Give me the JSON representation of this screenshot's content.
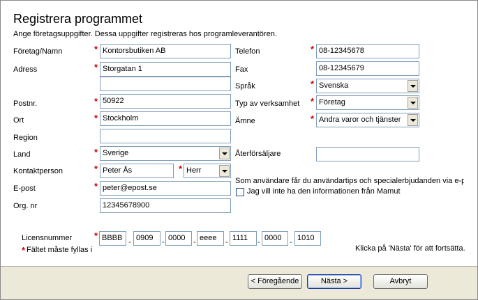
{
  "header": {
    "title": "Registrera programmet",
    "subtitle": "Ange företagsuppgifter. Dessa uppgifter registreras hos programleverantören."
  },
  "left": {
    "company_label": "Företag/Namn",
    "company_value": "Kontorsbutiken AB",
    "address_label": "Adress",
    "address_value": "Storgatan 1",
    "address2_value": "",
    "postal_label": "Postnr.",
    "postal_value": "50922",
    "city_label": "Ort",
    "city_value": "Stockholm",
    "region_label": "Region",
    "region_value": "",
    "country_label": "Land",
    "country_value": "Sverige",
    "contact_label": "Kontaktperson",
    "contact_value": "Peter Ås",
    "salutation_value": "Herr",
    "email_label": "E-post",
    "email_value": "peter@epost.se",
    "org_label": "Org. nr",
    "org_value": "12345678900"
  },
  "right": {
    "phone_label": "Telefon",
    "phone_value": "08-12345678",
    "fax_label": "Fax",
    "fax_value": "08-12345679",
    "language_label": "Språk",
    "language_value": "Svenska",
    "business_label": "Typ av verksamhet",
    "business_value": "Företag",
    "subject_label": "Ämne",
    "subject_value": "Andra varor och tjänster",
    "reseller_label": "Återförsäljare",
    "reseller_value": "",
    "info_text": "Som användare får du användartips och specialerbjudanden via e-post.",
    "optout_label": "Jag vill inte ha den informationen från Mamut"
  },
  "license": {
    "label": "Licensnummer",
    "parts": [
      "BBBB",
      "0909",
      "0000",
      "eeee",
      "1111",
      "0000",
      "1010"
    ],
    "separator": "-"
  },
  "footer": {
    "required_note": "Fältet måste fyllas i",
    "next_hint": "Klicka på 'Nästa' för att fortsätta.",
    "back_label": "< Föregående",
    "next_label": "Nästa >",
    "cancel_label": "Avbryt"
  },
  "colors": {
    "required": "#d00000",
    "border": "#7f9db9",
    "bar": "#ece9d8"
  }
}
